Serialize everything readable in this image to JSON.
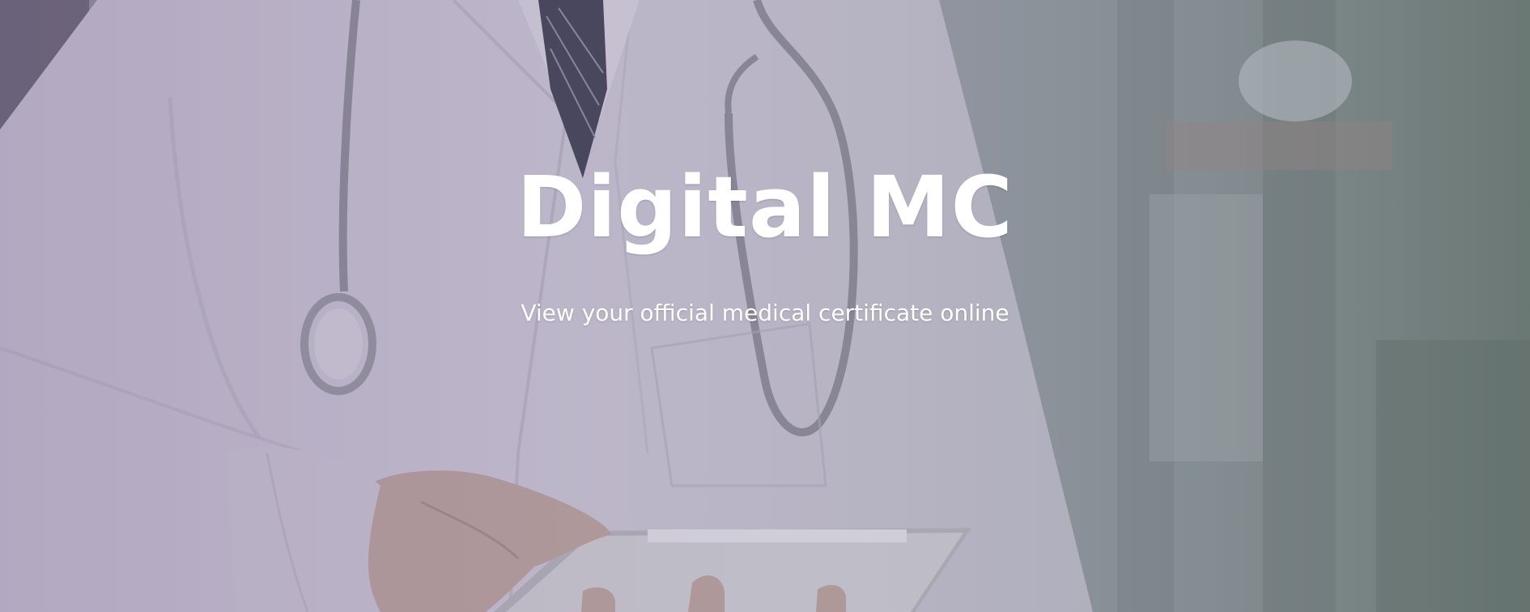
{
  "hero": {
    "title": "Digital MC",
    "subtitle": "View your official medical certificate online"
  }
}
